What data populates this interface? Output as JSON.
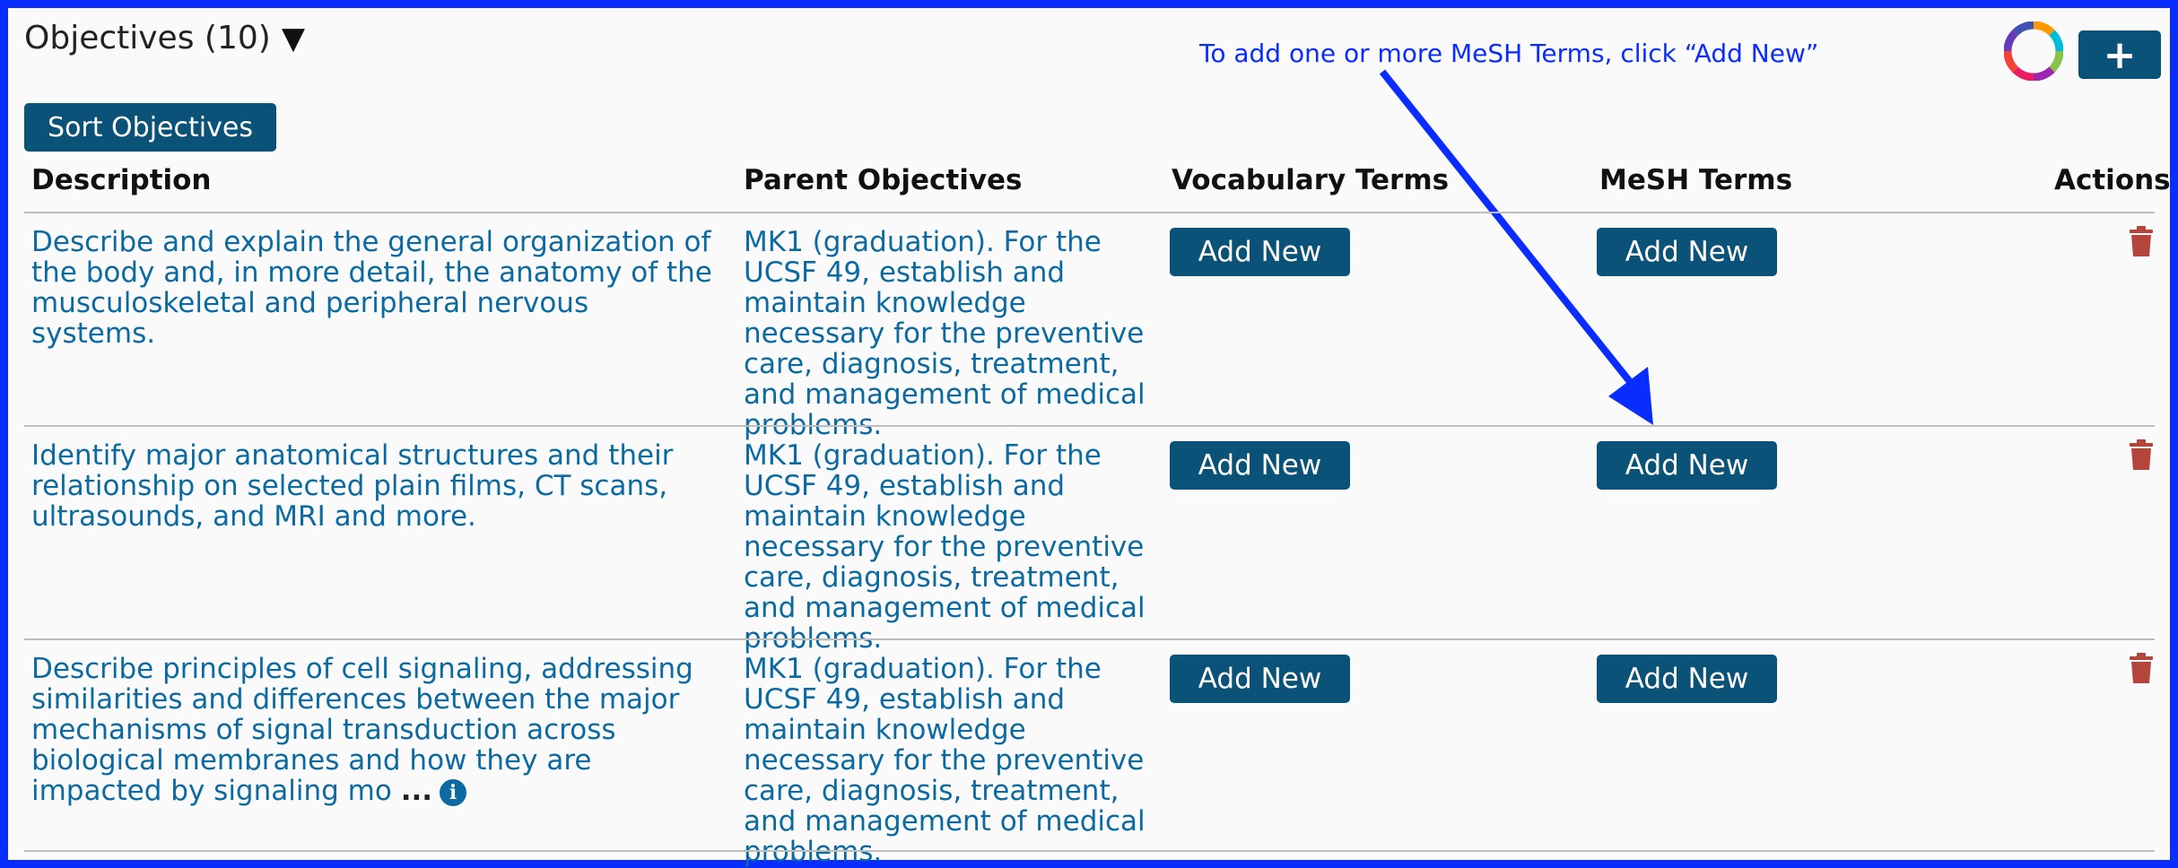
{
  "header": {
    "title": "Objectives (10)",
    "caret_glyph": "▼",
    "sort_button": "Sort Objectives",
    "add_button_glyph": "+",
    "progress_icon": "color-ring-icon"
  },
  "annotation": {
    "text": "To add one or more MeSH Terms, click “Add New”",
    "color": "#0a2dff"
  },
  "columns": {
    "description": "Description",
    "parent": "Parent Objectives",
    "vocabulary": "Vocabulary Terms",
    "mesh": "MeSH Terms",
    "actions": "Actions"
  },
  "rows": [
    {
      "description": "Describe and explain the general organization of the body and, in more detail, the anatomy of the musculoskeletal and peripheral nervous systems.",
      "parent": "MK1 (graduation). For the UCSF 49, establish and maintain knowledge necessary for the preventive care, diagnosis, treatment, and management of medical problems.",
      "vocab_button": "Add New",
      "mesh_button": "Add New"
    },
    {
      "description": "Identify major anatomical structures and their relationship on selected plain films, CT scans, ultrasounds, and MRI and more.",
      "parent": "MK1 (graduation). For the UCSF 49, establish and maintain knowledge necessary for the preventive care, diagnosis, treatment, and management of medical problems.",
      "vocab_button": "Add New",
      "mesh_button": "Add New"
    },
    {
      "description": "Describe principles of cell signaling, addressing similarities and differences between the major mechanisms of signal transduction across biological membranes and how they are impacted by signaling mo",
      "ellipsis": "...",
      "parent": "MK1 (graduation). For the UCSF 49, establish and maintain knowledge necessary for the preventive care, diagnosis, treatment, and management of medical problems.",
      "vocab_button": "Add New",
      "mesh_button": "Add New"
    }
  ],
  "colors": {
    "frame_border": "#0a2dff",
    "button_bg": "#0b5278",
    "link_text": "#0a6aa1",
    "trash": "#b3453b"
  }
}
